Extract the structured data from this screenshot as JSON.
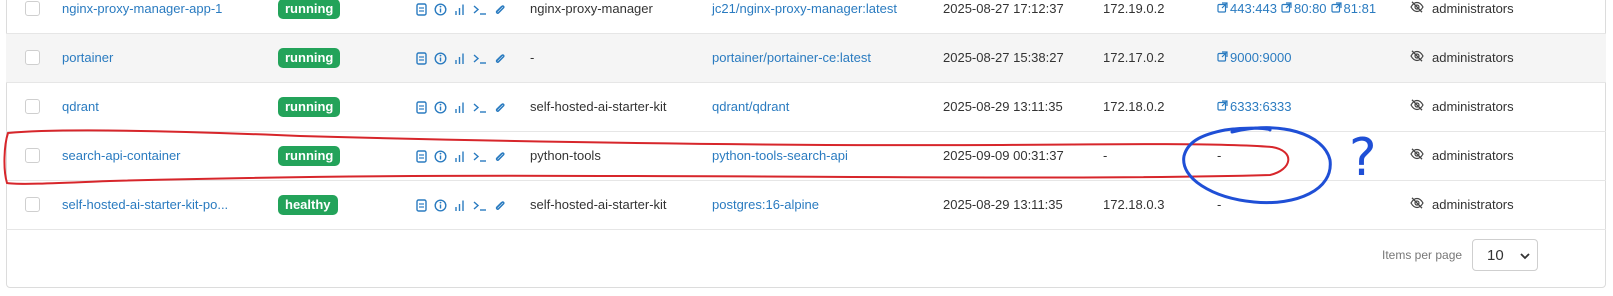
{
  "colors": {
    "badge_green": "#23a35a",
    "link_blue": "#2a7bc0",
    "annotation_red": "#d7262b",
    "annotation_blue": "#1f4fd6"
  },
  "action_icons": [
    "logs-icon",
    "inspect-icon",
    "stats-icon",
    "console-icon",
    "attach-icon"
  ],
  "rows": [
    {
      "name": "nginx-proxy-manager-app-1",
      "status": "running",
      "stack": "nginx-proxy-manager",
      "image": "jc21/nginx-proxy-manager:latest",
      "created": "2025-08-27 17:12:37",
      "ip": "172.19.0.2",
      "ports": [
        "443:443",
        "80:80",
        "81:81"
      ],
      "ownership": "administrators"
    },
    {
      "name": "portainer",
      "status": "running",
      "stack": "-",
      "image": "portainer/portainer-ce:latest",
      "created": "2025-08-27 15:38:27",
      "ip": "172.17.0.2",
      "ports": [
        "9000:9000"
      ],
      "ownership": "administrators"
    },
    {
      "name": "qdrant",
      "status": "running",
      "stack": "self-hosted-ai-starter-kit",
      "image": "qdrant/qdrant",
      "created": "2025-08-29 13:11:35",
      "ip": "172.18.0.2",
      "ports": [
        "6333:6333"
      ],
      "ownership": "administrators"
    },
    {
      "name": "search-api-container",
      "status": "running",
      "stack": "python-tools",
      "image": "python-tools-search-api",
      "created": "2025-09-09 00:31:37",
      "ip": "-",
      "ports_text": "-",
      "ownership": "administrators"
    },
    {
      "name": "self-hosted-ai-starter-kit-po...",
      "status": "healthy",
      "stack": "self-hosted-ai-starter-kit",
      "image": "postgres:16-alpine",
      "created": "2025-08-29 13:11:35",
      "ip": "172.18.0.3",
      "ports_text": "-",
      "ownership": "administrators"
    }
  ],
  "pagination": {
    "items_per_page_label": "Items per page",
    "items_per_page_value": "10"
  },
  "annotation": {
    "question_mark": "?"
  }
}
